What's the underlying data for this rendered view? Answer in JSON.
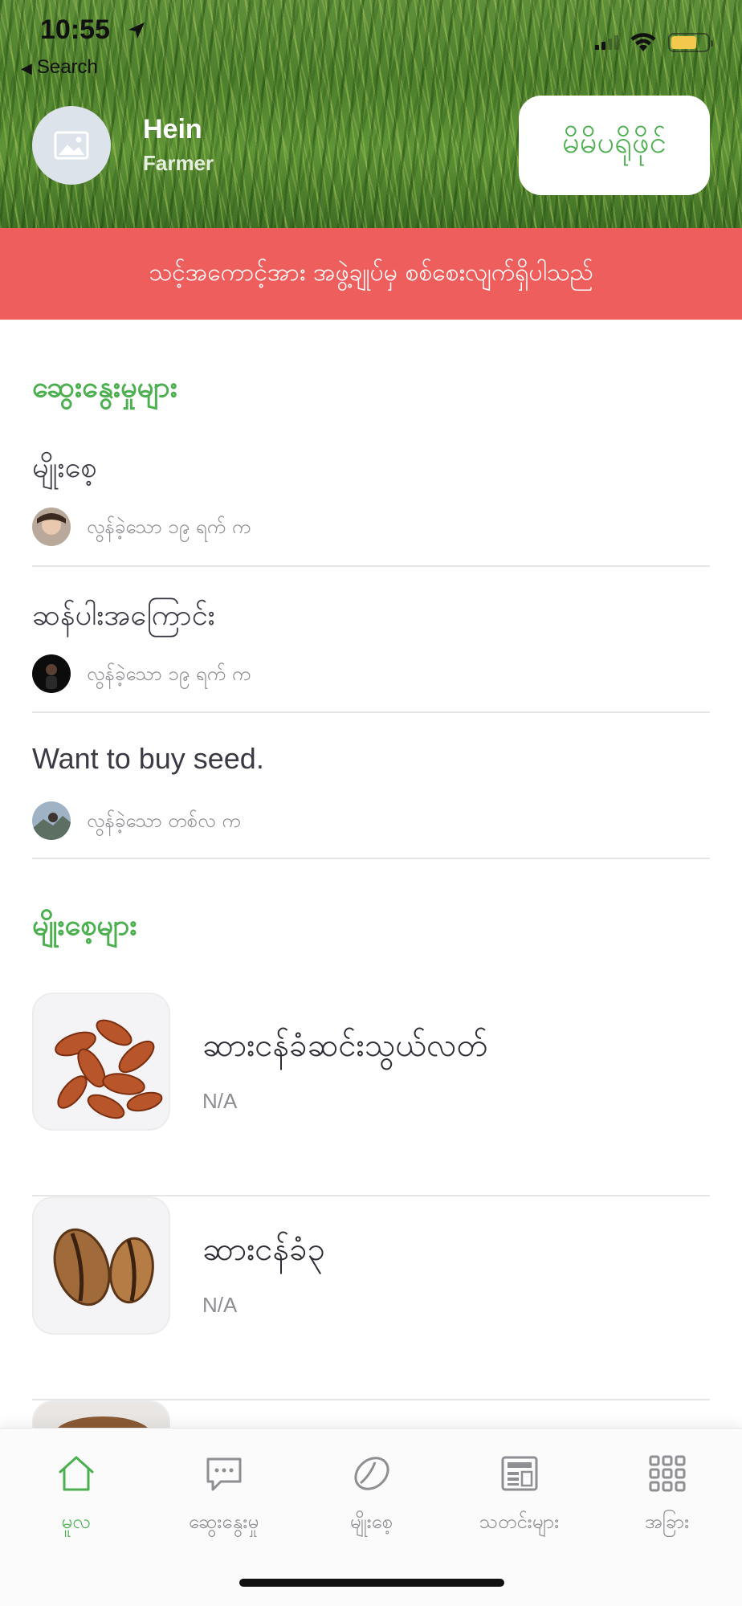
{
  "status_bar": {
    "time": "10:55",
    "back_label": "Search"
  },
  "profile": {
    "name": "Hein",
    "role": "Farmer",
    "avatar_icon": "image-placeholder-icon",
    "pending_button": "မိမိပရိုဖိုင်"
  },
  "alert": {
    "text": "သင့်အကောင့်အား အဖွဲ့ချုပ်မှ စစ်စေးလျက်ရှိပါသည်",
    "color": "#ee5e5c"
  },
  "discussions": {
    "title": "ဆွေးနွေးမှုများ",
    "items": [
      {
        "title": "မျိုးစေ့",
        "meta": "လွန်ခဲ့သော ၁၉ ရက် က"
      },
      {
        "title": "ဆန်ပါးအကြောင်း",
        "meta": "လွန်ခဲ့သော ၁၉ ရက် က"
      },
      {
        "title": "Want to buy seed.",
        "meta": "လွန်ခဲ့သော တစ်လ က"
      }
    ]
  },
  "seeds": {
    "title": "မျိုးစေ့များ",
    "items": [
      {
        "name": "ဆားငန်ခံဆင်းသွယ်လတ်",
        "sub": "N/A"
      },
      {
        "name": "ဆားငန်ခံ၃",
        "sub": "N/A"
      }
    ]
  },
  "tabs": [
    {
      "label": "မူလ",
      "icon": "home-icon",
      "active": true
    },
    {
      "label": "ဆွေးနွေးမှု",
      "icon": "chat-bubble-icon",
      "active": false
    },
    {
      "label": "မျိုးစေ့",
      "icon": "seed-icon",
      "active": false
    },
    {
      "label": "သတင်းများ",
      "icon": "newspaper-icon",
      "active": false
    },
    {
      "label": "အခြား",
      "icon": "grid-icon",
      "active": false
    }
  ],
  "accent_color": "#4caf50"
}
